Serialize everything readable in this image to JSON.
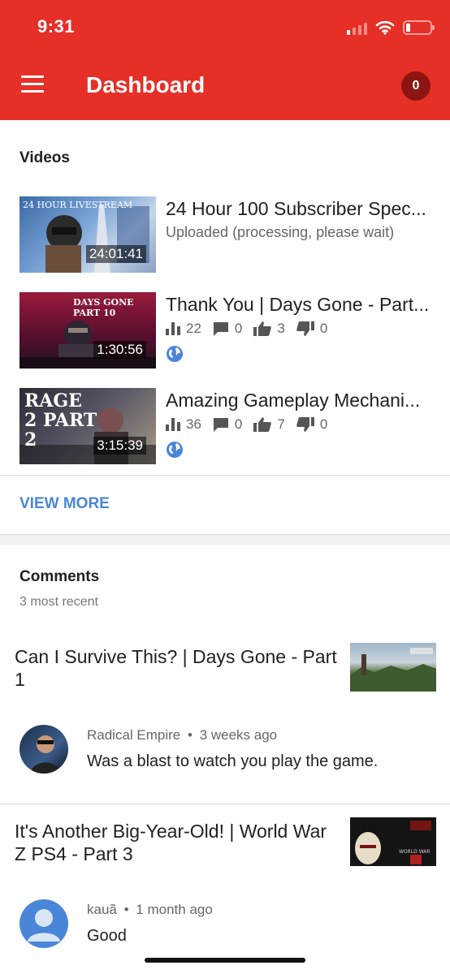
{
  "status_bar": {
    "time": "9:31"
  },
  "header": {
    "title": "Dashboard",
    "notification_count": "0",
    "accent_color": "#e62f27"
  },
  "videos_section": {
    "title": "Videos",
    "items": [
      {
        "thumb_text": "24 HOUR LIVESTREAM",
        "duration": "24:01:41",
        "title": "24 Hour 100 Subscriber Spec...",
        "status": "Uploaded (processing, please wait)"
      },
      {
        "thumb_text": "DAYS GONE PART 10",
        "duration": "1:30:56",
        "title": "Thank You | Days Gone - Part...",
        "views": "22",
        "comments": "0",
        "likes": "3",
        "dislikes": "0"
      },
      {
        "thumb_text": "RAGE 2 PART 2",
        "duration": "3:15:39",
        "title": "Amazing Gameplay Mechani...",
        "views": "36",
        "comments": "0",
        "likes": "7",
        "dislikes": "0"
      }
    ],
    "view_more_label": "VIEW MORE"
  },
  "comments_section": {
    "title": "Comments",
    "subtitle": "3 most recent",
    "items": [
      {
        "video_title": "Can I Survive This? | Days Gone - Part 1",
        "author": "Radical Empire",
        "separator": "•",
        "time": "3 weeks ago",
        "text": "Was a blast to watch you play the game."
      },
      {
        "video_title": "It's Another Big-Year-Old! | World War Z PS4 - Part 3",
        "author": "kauã",
        "separator": "•",
        "time": "1 month ago",
        "text": "Good"
      }
    ]
  },
  "icons": [
    "menu-icon",
    "wifi-icon",
    "battery-icon",
    "views-icon",
    "comments-icon",
    "likes-icon",
    "dislikes-icon",
    "globe-icon",
    "default-avatar-icon"
  ]
}
